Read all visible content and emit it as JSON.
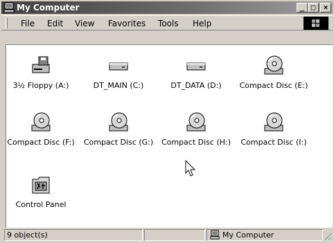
{
  "window": {
    "title": "My Computer",
    "icon": "my-computer-icon",
    "buttons": {
      "minimize": "_",
      "maximize": "□",
      "close": "×"
    }
  },
  "menu": [
    "File",
    "Edit",
    "View",
    "Favorites",
    "Tools",
    "Help"
  ],
  "items": [
    {
      "label": "3½ Floppy (A:)",
      "icon": "floppy-drive-icon"
    },
    {
      "label": "DT_MAIN (C:)",
      "icon": "hard-drive-icon"
    },
    {
      "label": "DT_DATA (D:)",
      "icon": "hard-drive-icon"
    },
    {
      "label": "Compact Disc (E:)",
      "icon": "cd-drive-icon"
    },
    {
      "label": "Compact Disc (F:)",
      "icon": "cd-drive-icon"
    },
    {
      "label": "Compact Disc (G:)",
      "icon": "cd-drive-icon"
    },
    {
      "label": "Compact Disc (H:)",
      "icon": "cd-drive-icon"
    },
    {
      "label": "Compact Disc (I:)",
      "icon": "cd-drive-icon"
    },
    {
      "label": "Control Panel",
      "icon": "control-panel-icon"
    }
  ],
  "status": {
    "count": "9 object(s)",
    "location": "My Computer"
  }
}
